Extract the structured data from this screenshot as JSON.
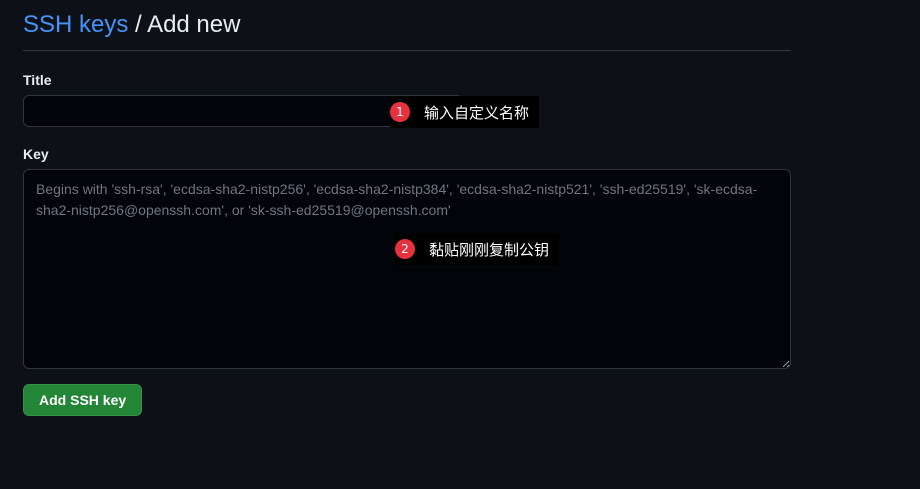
{
  "header": {
    "breadcrumb_link": "SSH keys",
    "separator": " / ",
    "current": "Add new"
  },
  "form": {
    "title_label": "Title",
    "title_value": "",
    "key_label": "Key",
    "key_value": "",
    "key_placeholder": "Begins with 'ssh-rsa', 'ecdsa-sha2-nistp256', 'ecdsa-sha2-nistp384', 'ecdsa-sha2-nistp521', 'ssh-ed25519', 'sk-ecdsa-sha2-nistp256@openssh.com', or 'sk-ssh-ed25519@openssh.com'",
    "submit_label": "Add SSH key"
  },
  "annotations": [
    {
      "number": "1",
      "text": "输入自定义名称"
    },
    {
      "number": "2",
      "text": "黏贴刚刚复制公钥"
    }
  ],
  "colors": {
    "background": "#0d1117",
    "link": "#4493f8",
    "primary_button": "#238636",
    "annotation_badge": "#e5323e"
  }
}
